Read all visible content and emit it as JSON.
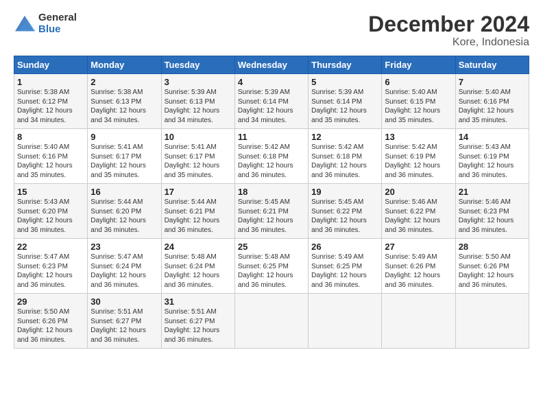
{
  "logo": {
    "general": "General",
    "blue": "Blue"
  },
  "title": "December 2024",
  "subtitle": "Kore, Indonesia",
  "weekdays": [
    "Sunday",
    "Monday",
    "Tuesday",
    "Wednesday",
    "Thursday",
    "Friday",
    "Saturday"
  ],
  "weeks": [
    [
      {
        "day": "1",
        "info": "Sunrise: 5:38 AM\nSunset: 6:12 PM\nDaylight: 12 hours\nand 34 minutes."
      },
      {
        "day": "2",
        "info": "Sunrise: 5:38 AM\nSunset: 6:13 PM\nDaylight: 12 hours\nand 34 minutes."
      },
      {
        "day": "3",
        "info": "Sunrise: 5:39 AM\nSunset: 6:13 PM\nDaylight: 12 hours\nand 34 minutes."
      },
      {
        "day": "4",
        "info": "Sunrise: 5:39 AM\nSunset: 6:14 PM\nDaylight: 12 hours\nand 34 minutes."
      },
      {
        "day": "5",
        "info": "Sunrise: 5:39 AM\nSunset: 6:14 PM\nDaylight: 12 hours\nand 35 minutes."
      },
      {
        "day": "6",
        "info": "Sunrise: 5:40 AM\nSunset: 6:15 PM\nDaylight: 12 hours\nand 35 minutes."
      },
      {
        "day": "7",
        "info": "Sunrise: 5:40 AM\nSunset: 6:16 PM\nDaylight: 12 hours\nand 35 minutes."
      }
    ],
    [
      {
        "day": "8",
        "info": "Sunrise: 5:40 AM\nSunset: 6:16 PM\nDaylight: 12 hours\nand 35 minutes."
      },
      {
        "day": "9",
        "info": "Sunrise: 5:41 AM\nSunset: 6:17 PM\nDaylight: 12 hours\nand 35 minutes."
      },
      {
        "day": "10",
        "info": "Sunrise: 5:41 AM\nSunset: 6:17 PM\nDaylight: 12 hours\nand 35 minutes."
      },
      {
        "day": "11",
        "info": "Sunrise: 5:42 AM\nSunset: 6:18 PM\nDaylight: 12 hours\nand 36 minutes."
      },
      {
        "day": "12",
        "info": "Sunrise: 5:42 AM\nSunset: 6:18 PM\nDaylight: 12 hours\nand 36 minutes."
      },
      {
        "day": "13",
        "info": "Sunrise: 5:42 AM\nSunset: 6:19 PM\nDaylight: 12 hours\nand 36 minutes."
      },
      {
        "day": "14",
        "info": "Sunrise: 5:43 AM\nSunset: 6:19 PM\nDaylight: 12 hours\nand 36 minutes."
      }
    ],
    [
      {
        "day": "15",
        "info": "Sunrise: 5:43 AM\nSunset: 6:20 PM\nDaylight: 12 hours\nand 36 minutes."
      },
      {
        "day": "16",
        "info": "Sunrise: 5:44 AM\nSunset: 6:20 PM\nDaylight: 12 hours\nand 36 minutes."
      },
      {
        "day": "17",
        "info": "Sunrise: 5:44 AM\nSunset: 6:21 PM\nDaylight: 12 hours\nand 36 minutes."
      },
      {
        "day": "18",
        "info": "Sunrise: 5:45 AM\nSunset: 6:21 PM\nDaylight: 12 hours\nand 36 minutes."
      },
      {
        "day": "19",
        "info": "Sunrise: 5:45 AM\nSunset: 6:22 PM\nDaylight: 12 hours\nand 36 minutes."
      },
      {
        "day": "20",
        "info": "Sunrise: 5:46 AM\nSunset: 6:22 PM\nDaylight: 12 hours\nand 36 minutes."
      },
      {
        "day": "21",
        "info": "Sunrise: 5:46 AM\nSunset: 6:23 PM\nDaylight: 12 hours\nand 36 minutes."
      }
    ],
    [
      {
        "day": "22",
        "info": "Sunrise: 5:47 AM\nSunset: 6:23 PM\nDaylight: 12 hours\nand 36 minutes."
      },
      {
        "day": "23",
        "info": "Sunrise: 5:47 AM\nSunset: 6:24 PM\nDaylight: 12 hours\nand 36 minutes."
      },
      {
        "day": "24",
        "info": "Sunrise: 5:48 AM\nSunset: 6:24 PM\nDaylight: 12 hours\nand 36 minutes."
      },
      {
        "day": "25",
        "info": "Sunrise: 5:48 AM\nSunset: 6:25 PM\nDaylight: 12 hours\nand 36 minutes."
      },
      {
        "day": "26",
        "info": "Sunrise: 5:49 AM\nSunset: 6:25 PM\nDaylight: 12 hours\nand 36 minutes."
      },
      {
        "day": "27",
        "info": "Sunrise: 5:49 AM\nSunset: 6:26 PM\nDaylight: 12 hours\nand 36 minutes."
      },
      {
        "day": "28",
        "info": "Sunrise: 5:50 AM\nSunset: 6:26 PM\nDaylight: 12 hours\nand 36 minutes."
      }
    ],
    [
      {
        "day": "29",
        "info": "Sunrise: 5:50 AM\nSunset: 6:26 PM\nDaylight: 12 hours\nand 36 minutes."
      },
      {
        "day": "30",
        "info": "Sunrise: 5:51 AM\nSunset: 6:27 PM\nDaylight: 12 hours\nand 36 minutes."
      },
      {
        "day": "31",
        "info": "Sunrise: 5:51 AM\nSunset: 6:27 PM\nDaylight: 12 hours\nand 36 minutes."
      },
      null,
      null,
      null,
      null
    ]
  ]
}
